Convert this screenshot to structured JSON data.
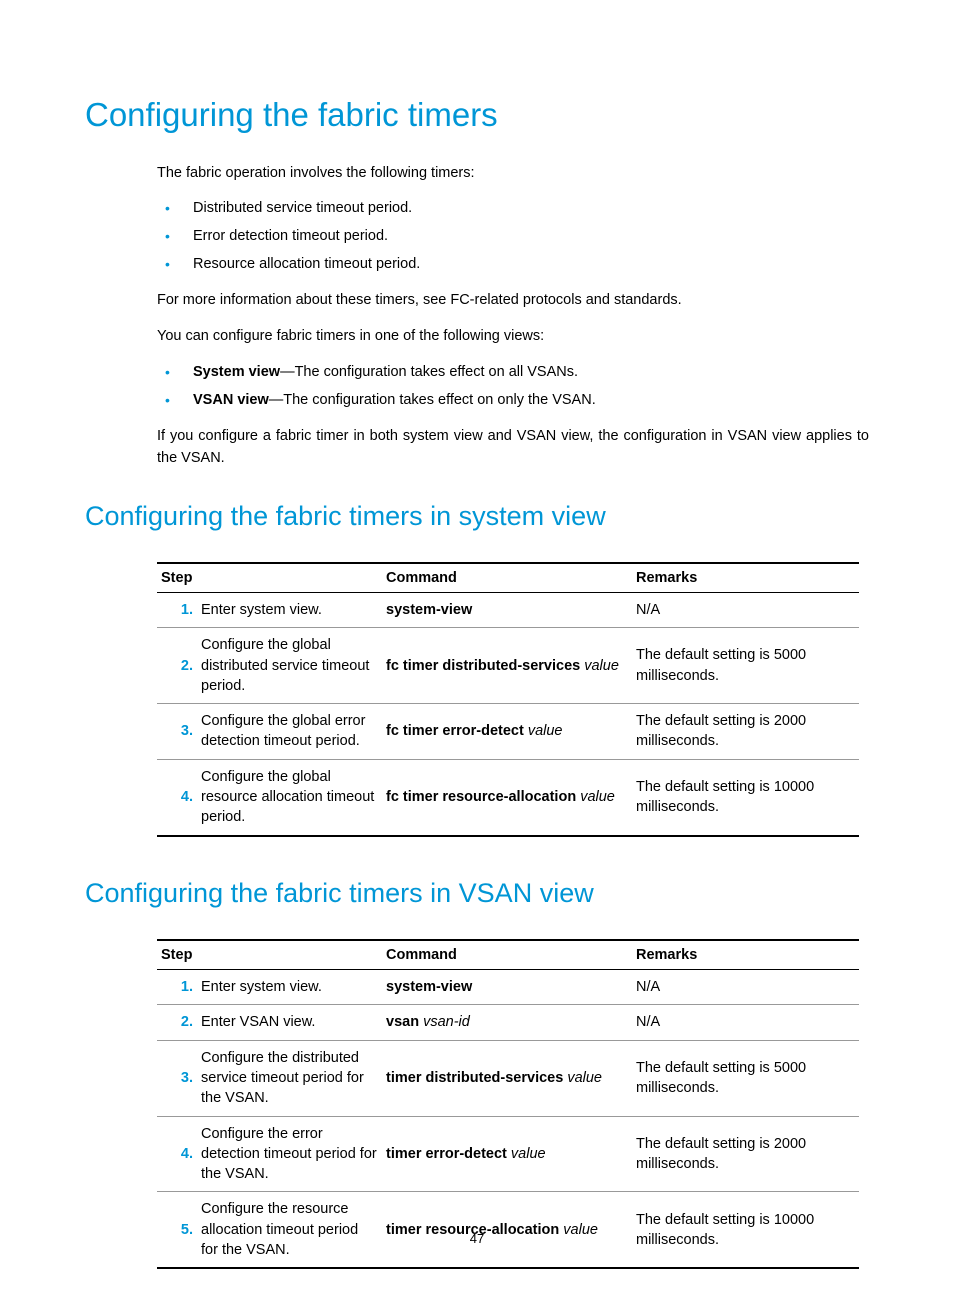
{
  "h1": "Configuring the fabric timers",
  "intro": "The fabric operation involves the following timers:",
  "timers_list": [
    "Distributed service timeout period.",
    "Error detection timeout period.",
    "Resource allocation timeout period."
  ],
  "more_info": "For more information about these timers, see FC-related protocols and standards.",
  "views_intro": "You can configure fabric timers in one of the following views:",
  "views_list": [
    {
      "bold": "System view",
      "rest": "—The configuration takes effect on all VSANs."
    },
    {
      "bold": "VSAN view",
      "rest": "—The configuration takes effect on only the VSAN."
    }
  ],
  "both_note": "If you configure a fabric timer in both system view and VSAN view, the configuration in VSAN view applies to the VSAN.",
  "sys_view": {
    "heading": "Configuring the fabric timers in system view",
    "headers": {
      "step": "Step",
      "cmd": "Command",
      "rem": "Remarks"
    },
    "rows": [
      {
        "num": "1.",
        "desc": "Enter system view.",
        "cmd_b": "system-view",
        "cmd_i": "",
        "rem": "N/A"
      },
      {
        "num": "2.",
        "desc": "Configure the global distributed service timeout period.",
        "cmd_b": "fc timer distributed-services",
        "cmd_i": " value",
        "rem": "The default setting is 5000 milliseconds."
      },
      {
        "num": "3.",
        "desc": "Configure the global error detection timeout period.",
        "cmd_b": "fc timer error-detect",
        "cmd_i": " value",
        "rem": "The default setting is 2000 milliseconds."
      },
      {
        "num": "4.",
        "desc": "Configure the global resource allocation timeout period.",
        "cmd_b": "fc timer resource-allocation",
        "cmd_i": " value",
        "rem": "The default setting is 10000 milliseconds."
      }
    ]
  },
  "vsan_view": {
    "heading": "Configuring the fabric timers in VSAN view",
    "headers": {
      "step": "Step",
      "cmd": "Command",
      "rem": "Remarks"
    },
    "rows": [
      {
        "num": "1.",
        "desc": "Enter system view.",
        "cmd_b": "system-view",
        "cmd_i": "",
        "rem": "N/A"
      },
      {
        "num": "2.",
        "desc": "Enter VSAN view.",
        "cmd_b": "vsan",
        "cmd_i": " vsan-id",
        "rem": "N/A"
      },
      {
        "num": "3.",
        "desc": "Configure the distributed service timeout period for the VSAN.",
        "cmd_b": "timer distributed-services",
        "cmd_i": " value",
        "rem": "The default setting is 5000 milliseconds."
      },
      {
        "num": "4.",
        "desc": "Configure the error detection timeout period for the VSAN.",
        "cmd_b": "timer error-detect",
        "cmd_i": " value",
        "rem": "The default setting is 2000 milliseconds."
      },
      {
        "num": "5.",
        "desc": "Configure the resource allocation timeout period for the VSAN.",
        "cmd_b": "timer resource-allocation",
        "cmd_i": " value",
        "rem": "The default setting is 10000 milliseconds."
      }
    ]
  },
  "page_number": "47"
}
